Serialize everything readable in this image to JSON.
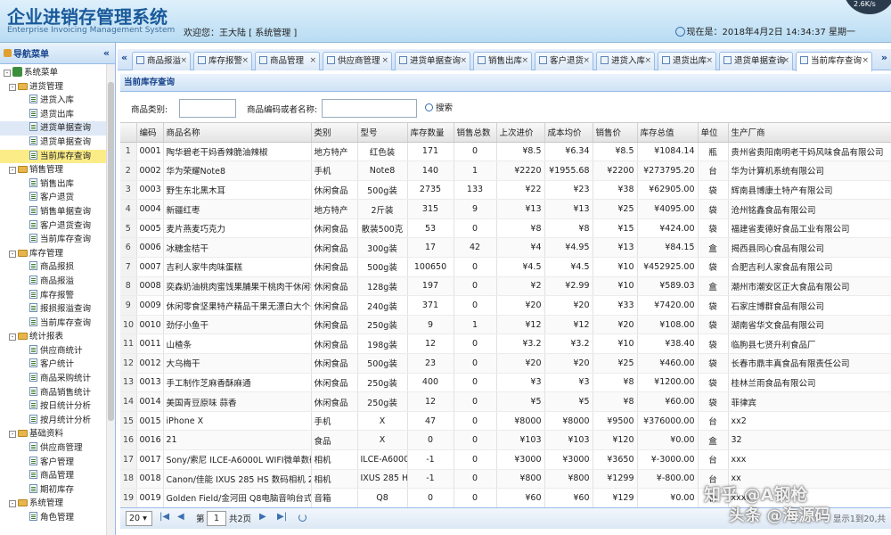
{
  "header": {
    "title": "企业进销存管理系统",
    "subtitle": "Enterprise Invoicing Management System",
    "welcome": "欢迎您：王大陆  [  系统管理  ]",
    "datetime": "现在是：2018年4月2日  14:34:37  星期一",
    "speed": "2.6K/s"
  },
  "sidebar": {
    "title": "导航菜单",
    "collapse": "«",
    "tree": [
      {
        "label": "系统菜单",
        "level": 0,
        "type": "root",
        "expander": "-"
      },
      {
        "label": "进货管理",
        "level": 1,
        "type": "folder",
        "expander": "-"
      },
      {
        "label": "进货入库",
        "level": 2,
        "type": "leaf"
      },
      {
        "label": "退货出库",
        "level": 2,
        "type": "leaf"
      },
      {
        "label": "进货单据查询",
        "level": 2,
        "type": "leaf",
        "state": "hover"
      },
      {
        "label": "退货单据查询",
        "level": 2,
        "type": "leaf"
      },
      {
        "label": "当前库存查询",
        "level": 2,
        "type": "leaf",
        "state": "selected"
      },
      {
        "label": "销售管理",
        "level": 1,
        "type": "folder",
        "expander": "-"
      },
      {
        "label": "销售出库",
        "level": 2,
        "type": "leaf"
      },
      {
        "label": "客户退货",
        "level": 2,
        "type": "leaf"
      },
      {
        "label": "销售单据查询",
        "level": 2,
        "type": "leaf"
      },
      {
        "label": "客户退货查询",
        "level": 2,
        "type": "leaf"
      },
      {
        "label": "当前库存查询",
        "level": 2,
        "type": "leaf"
      },
      {
        "label": "库存管理",
        "level": 1,
        "type": "folder",
        "expander": "-"
      },
      {
        "label": "商品报损",
        "level": 2,
        "type": "leaf"
      },
      {
        "label": "商品报溢",
        "level": 2,
        "type": "leaf"
      },
      {
        "label": "库存报警",
        "level": 2,
        "type": "leaf"
      },
      {
        "label": "报损报溢查询",
        "level": 2,
        "type": "leaf"
      },
      {
        "label": "当前库存查询",
        "level": 2,
        "type": "leaf"
      },
      {
        "label": "统计报表",
        "level": 1,
        "type": "folder",
        "expander": "-"
      },
      {
        "label": "供应商统计",
        "level": 2,
        "type": "leaf"
      },
      {
        "label": "客户统计",
        "level": 2,
        "type": "leaf"
      },
      {
        "label": "商品采购统计",
        "level": 2,
        "type": "leaf"
      },
      {
        "label": "商品销售统计",
        "level": 2,
        "type": "leaf"
      },
      {
        "label": "按日统计分析",
        "level": 2,
        "type": "leaf"
      },
      {
        "label": "按月统计分析",
        "level": 2,
        "type": "leaf"
      },
      {
        "label": "基础资料",
        "level": 1,
        "type": "folder",
        "expander": "-"
      },
      {
        "label": "供应商管理",
        "level": 2,
        "type": "leaf"
      },
      {
        "label": "客户管理",
        "level": 2,
        "type": "leaf"
      },
      {
        "label": "商品管理",
        "level": 2,
        "type": "leaf"
      },
      {
        "label": "期初库存",
        "level": 2,
        "type": "leaf"
      },
      {
        "label": "系统管理",
        "level": 1,
        "type": "folder",
        "expander": "-"
      },
      {
        "label": "角色管理",
        "level": 2,
        "type": "leaf"
      }
    ]
  },
  "tabs": {
    "nav_left": "«",
    "nav_right": "»",
    "close": "×",
    "items": [
      {
        "label": "商品报溢"
      },
      {
        "label": "库存报警"
      },
      {
        "label": "商品管理"
      },
      {
        "label": "供应商管理"
      },
      {
        "label": "进货单据查询"
      },
      {
        "label": "销售出库"
      },
      {
        "label": "客户退货"
      },
      {
        "label": "进货入库"
      },
      {
        "label": "退货出库"
      },
      {
        "label": "退货单据查询"
      },
      {
        "label": "当前库存查询",
        "active": true
      }
    ]
  },
  "panel": {
    "title": "当前库存查询",
    "search": {
      "category_label": "商品类别:",
      "category_value": "",
      "keyword_label": "商品编码或者名称:",
      "keyword_value": "",
      "search_button": "搜索"
    }
  },
  "grid": {
    "columns": [
      "",
      "编码",
      "商品名称",
      "类别",
      "型号",
      "库存数量",
      "销售总数",
      "上次进价",
      "成本均价",
      "销售价",
      "库存总值",
      "单位",
      "生产厂商"
    ],
    "rows": [
      [
        "1",
        "0001",
        "陶华碧老干妈香辣脆油辣椒",
        "地方特产",
        "红色装",
        "171",
        "0",
        "¥8.5",
        "¥6.34",
        "¥8.5",
        "¥1084.14",
        "瓶",
        "贵州省贵阳南明老干妈风味食品有限公司"
      ],
      [
        "2",
        "0002",
        "华为荣耀Note8",
        "手机",
        "Note8",
        "140",
        "1",
        "¥2220",
        "¥1955.68",
        "¥2200",
        "¥273795.20",
        "台",
        "华为计算机系统有限公司"
      ],
      [
        "3",
        "0003",
        "野生东北黑木耳",
        "休闲食品",
        "500g装",
        "2735",
        "133",
        "¥22",
        "¥23",
        "¥38",
        "¥62905.00",
        "袋",
        "辉南县博康土特产有限公司"
      ],
      [
        "4",
        "0004",
        "新疆红枣",
        "地方特产",
        "2斤装",
        "315",
        "9",
        "¥13",
        "¥13",
        "¥25",
        "¥4095.00",
        "袋",
        "沧州铭鑫食品有限公司"
      ],
      [
        "5",
        "0005",
        "麦片燕麦巧克力",
        "休闲食品",
        "散装500克",
        "53",
        "0",
        "¥8",
        "¥8",
        "¥15",
        "¥424.00",
        "袋",
        "福建省麦德好食品工业有限公司"
      ],
      [
        "6",
        "0006",
        "冰糖金桔干",
        "休闲食品",
        "300g装",
        "17",
        "42",
        "¥4",
        "¥4.95",
        "¥13",
        "¥84.15",
        "盒",
        "揭西县同心食品有限公司"
      ],
      [
        "7",
        "0007",
        "吉利人家牛肉味蛋糕",
        "休闲食品",
        "500g装",
        "100650",
        "0",
        "¥4.5",
        "¥4.5",
        "¥10",
        "¥452925.00",
        "袋",
        "合肥吉利人家食品有限公司"
      ],
      [
        "8",
        "0008",
        "奕森奶油桃肉蜜饯果脯果干桃肉干休闲零食",
        "休闲食品",
        "128g装",
        "197",
        "0",
        "¥2",
        "¥2.99",
        "¥10",
        "¥589.03",
        "盒",
        "潮州市潮安区正大食品有限公司"
      ],
      [
        "9",
        "0009",
        "休闲零食坚果特产精品干果无漂白大个开心果",
        "休闲食品",
        "240g装",
        "371",
        "0",
        "¥20",
        "¥20",
        "¥33",
        "¥7420.00",
        "袋",
        "石家庄博群食品有限公司"
      ],
      [
        "10",
        "0010",
        "劲仔小鱼干",
        "休闲食品",
        "250g装",
        "9",
        "1",
        "¥12",
        "¥12",
        "¥20",
        "¥108.00",
        "袋",
        "湖南省华文食品有限公司"
      ],
      [
        "11",
        "0011",
        "山楂条",
        "休闲食品",
        "198g装",
        "12",
        "0",
        "¥3.2",
        "¥3.2",
        "¥10",
        "¥38.40",
        "袋",
        "临朐县七贤升利食品厂"
      ],
      [
        "12",
        "0012",
        "大乌梅干",
        "休闲食品",
        "500g装",
        "23",
        "0",
        "¥20",
        "¥20",
        "¥25",
        "¥460.00",
        "袋",
        "长春市鼎丰真食品有限责任公司"
      ],
      [
        "13",
        "0013",
        "手工制作芝麻香酥麻通",
        "休闲食品",
        "250g装",
        "400",
        "0",
        "¥3",
        "¥3",
        "¥8",
        "¥1200.00",
        "袋",
        "桂林兰雨食品有限公司"
      ],
      [
        "14",
        "0014",
        "美国青豆原味 蒜香",
        "休闲食品",
        "250g装",
        "12",
        "0",
        "¥5",
        "¥5",
        "¥8",
        "¥60.00",
        "袋",
        "菲律宾"
      ],
      [
        "15",
        "0015",
        "iPhone X",
        "手机",
        "X",
        "47",
        "0",
        "¥8000",
        "¥8000",
        "¥9500",
        "¥376000.00",
        "台",
        "xx2"
      ],
      [
        "16",
        "0016",
        "21",
        "食品",
        "X",
        "0",
        "0",
        "¥103",
        "¥103",
        "¥120",
        "¥0.00",
        "盒",
        "32"
      ],
      [
        "17",
        "0017",
        "Sony/索尼 ILCE-A6000L WIFI微单数码相机",
        "相机",
        "ILCE-A6000L",
        "-1",
        "0",
        "¥3000",
        "¥3000",
        "¥3650",
        "¥-3000.00",
        "台",
        "xxx"
      ],
      [
        "18",
        "0018",
        "Canon/佳能 IXUS 285 HS 数码相机 2020万",
        "相机",
        "IXUS 285 HS",
        "-1",
        "0",
        "¥800",
        "¥800",
        "¥1299",
        "¥-800.00",
        "台",
        "xx"
      ],
      [
        "19",
        "0019",
        "Golden Field/金河田 Q8电脑音响台式多媒体",
        "音箱",
        "Q8",
        "0",
        "0",
        "¥60",
        "¥60",
        "¥129",
        "¥0.00",
        "台",
        "xxxx"
      ]
    ]
  },
  "pager": {
    "page_size": "20",
    "page_label_before": "第",
    "page_value": "1",
    "page_label_after": "共2页",
    "display_info": "显示1到20,共"
  },
  "watermark": {
    "line1": "知乎 @A钢枪",
    "line2": "头条 @海源码"
  }
}
